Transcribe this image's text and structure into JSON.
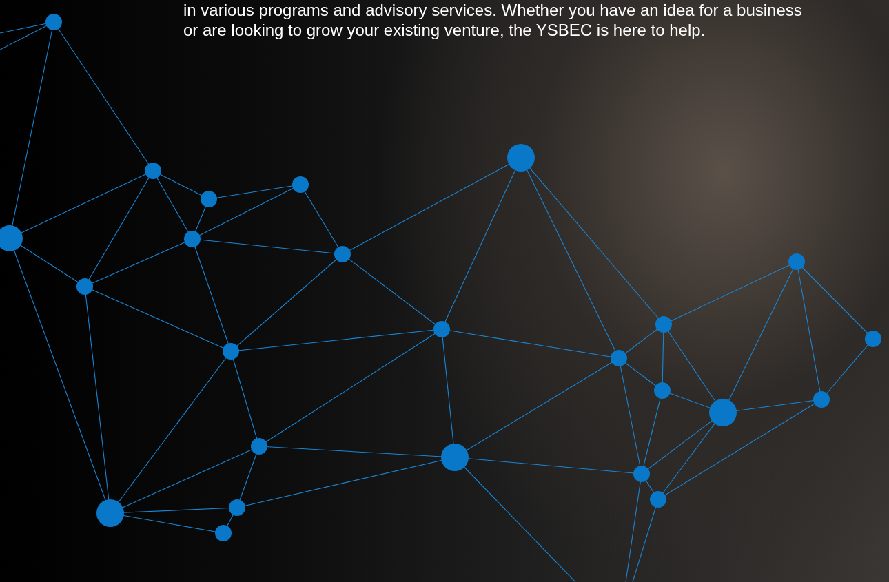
{
  "intro": {
    "lines": [
      "in various programs and advisory services. Whether you have an idea for a business",
      "or are looking to grow your existing venture, the YSBEC is here to help."
    ]
  }
}
